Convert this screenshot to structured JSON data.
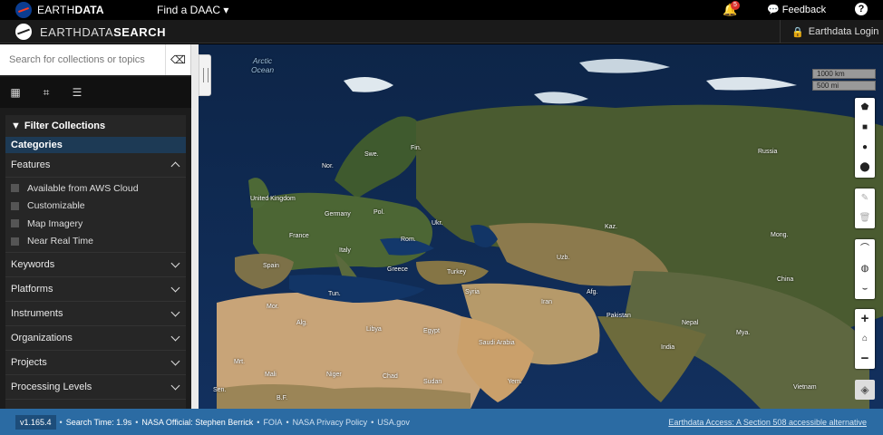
{
  "topbar": {
    "brand_plain": "EARTH",
    "brand_bold": "DATA",
    "daac_label": "Find a DAAC",
    "notification_count": "5",
    "feedback_label": "Feedback",
    "help_label": "?"
  },
  "appbar": {
    "title_plain": "EARTHDATA",
    "title_bold": "SEARCH",
    "login_label": "Earthdata Login"
  },
  "search": {
    "placeholder": "Search for collections or topics"
  },
  "icons": {
    "calendar": "calendar-icon",
    "crop": "crop-icon",
    "sliders": "sliders-icon",
    "eraser": "eraser-icon"
  },
  "filters": {
    "title": "Filter Collections",
    "categories_label": "Categories",
    "features_label": "Features",
    "features": [
      "Available from AWS Cloud",
      "Customizable",
      "Map Imagery",
      "Near Real Time"
    ],
    "sections": [
      "Keywords",
      "Platforms",
      "Instruments",
      "Organizations",
      "Projects",
      "Processing Levels"
    ]
  },
  "map": {
    "ocean_label_line1": "Arctic",
    "ocean_label_line2": "Ocean",
    "scale_km": "1000 km",
    "scale_mi": "500 mi",
    "labels": [
      "Fin.",
      "Swe.",
      "Nor.",
      "Russia",
      "United Kingdom",
      "Germany",
      "Pol.",
      "Ukr.",
      "France",
      "Rom.",
      "Kaz.",
      "Mong.",
      "Spain",
      "Italy",
      "Greece",
      "Turkey",
      "Uzb.",
      "Afg.",
      "Tun.",
      "Syria",
      "Iran",
      "China",
      "Mor.",
      "Alg.",
      "Libya",
      "Egypt",
      "Saudi Arabia",
      "Pakistan",
      "Nepal",
      "Mya.",
      "India",
      "Mrt.",
      "Mali",
      "Niger",
      "Chad",
      "Sudan",
      "Yem.",
      "Vietnam",
      "Sen.",
      "B.F."
    ]
  },
  "footer": {
    "version": "v1.165.4",
    "search_time": "Search Time: 1.9s",
    "official": "NASA Official: Stephen Berrick",
    "foia": "FOIA",
    "privacy": "NASA Privacy Policy",
    "usagov": "USA.gov",
    "accessible": "Earthdata Access: A Section 508 accessible alternative"
  },
  "colors": {
    "footer_bg": "#2b6ba3",
    "categories_bg": "#1d3a55",
    "sidebar_bg": "#1c1c1c"
  }
}
